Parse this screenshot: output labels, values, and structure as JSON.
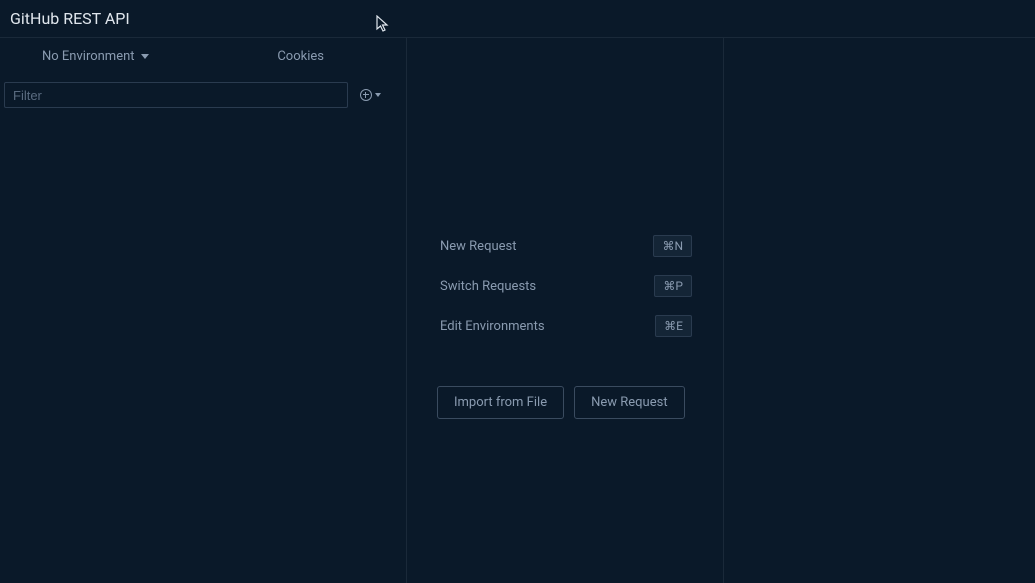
{
  "header": {
    "title": "GitHub REST API"
  },
  "sidebar": {
    "environment_label": "No Environment",
    "cookies_label": "Cookies",
    "filter_placeholder": "Filter"
  },
  "main": {
    "shortcuts": [
      {
        "label": "New Request",
        "key": "⌘N"
      },
      {
        "label": "Switch Requests",
        "key": "⌘P"
      },
      {
        "label": "Edit Environments",
        "key": "⌘E"
      }
    ],
    "import_button": "Import from File",
    "new_request_button": "New Request"
  }
}
